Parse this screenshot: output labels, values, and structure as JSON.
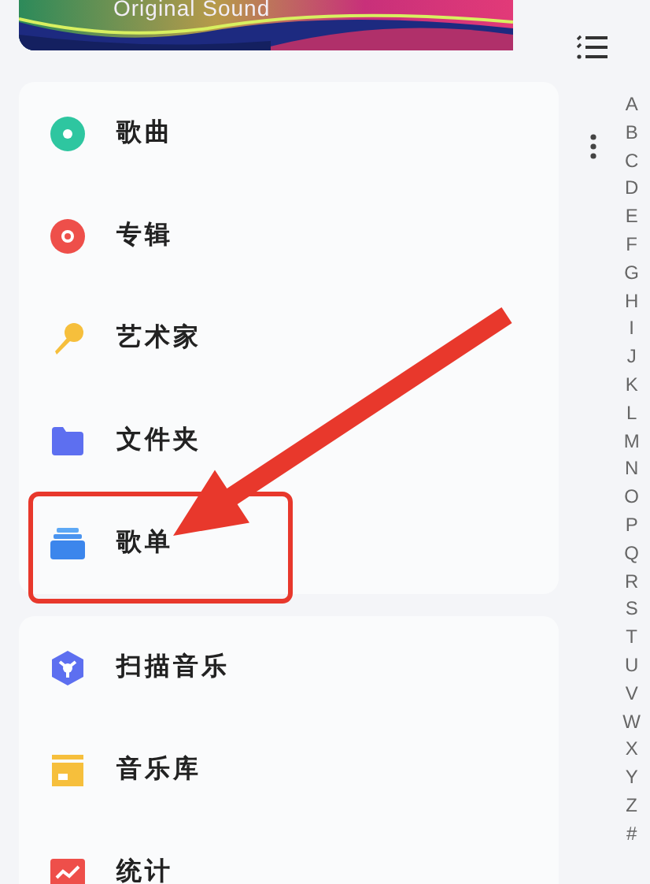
{
  "banner": {
    "caption": "Original Sound"
  },
  "library_items": [
    {
      "label": "歌曲"
    },
    {
      "label": "专辑"
    },
    {
      "label": "艺术家"
    },
    {
      "label": "文件夹"
    },
    {
      "label": "歌单"
    }
  ],
  "tool_items": [
    {
      "label": "扫描音乐"
    },
    {
      "label": "音乐库"
    },
    {
      "label": "统计"
    }
  ],
  "alphabet_index": [
    "A",
    "B",
    "C",
    "D",
    "E",
    "F",
    "G",
    "H",
    "I",
    "J",
    "K",
    "L",
    "M",
    "N",
    "O",
    "P",
    "Q",
    "R",
    "S",
    "T",
    "U",
    "V",
    "W",
    "X",
    "Y",
    "Z",
    "#"
  ]
}
